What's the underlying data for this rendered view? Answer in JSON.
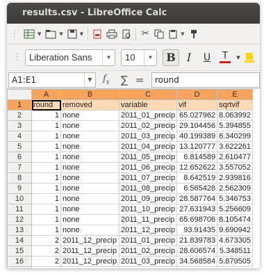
{
  "window": {
    "title": "results.csv - LibreOffice Calc"
  },
  "toolbar": {
    "font_name": "Liberation Sans",
    "font_size": "10",
    "bold_label": "B",
    "italic_label": "I",
    "underline_label": "U"
  },
  "formula_bar": {
    "name_box": "A1:E1",
    "fx_label": "f",
    "fx_sub": "x",
    "sigma_label": "∑",
    "equals_label": "=",
    "content": "round"
  },
  "sheet": {
    "columns": [
      "A",
      "B",
      "C",
      "D",
      "E"
    ],
    "rows": [
      {
        "n": "1",
        "round": "round",
        "removed": "removed",
        "variable": "variable",
        "vif": "vif",
        "sqrtvif": "sqrtvif"
      },
      {
        "n": "2",
        "round": "1",
        "removed": "none",
        "variable": "2011_01_precip",
        "vif": "65.027962",
        "sqrtvif": "8.063992"
      },
      {
        "n": "3",
        "round": "1",
        "removed": "none",
        "variable": "2011_02_precip",
        "vif": "29.104456",
        "sqrtvif": "5.394855"
      },
      {
        "n": "4",
        "round": "1",
        "removed": "none",
        "variable": "2011_03_precip",
        "vif": "40.199389",
        "sqrtvif": "6.340299"
      },
      {
        "n": "5",
        "round": "1",
        "removed": "none",
        "variable": "2011_04_precip",
        "vif": "13.120777",
        "sqrtvif": "3.622261"
      },
      {
        "n": "6",
        "round": "1",
        "removed": "none",
        "variable": "2011_05_precip",
        "vif": "6.814589",
        "sqrtvif": "2.610477"
      },
      {
        "n": "7",
        "round": "1",
        "removed": "none",
        "variable": "2011_06_precip",
        "vif": "12.652622",
        "sqrtvif": "3.557052"
      },
      {
        "n": "8",
        "round": "1",
        "removed": "none",
        "variable": "2011_07_precip",
        "vif": "8.642519",
        "sqrtvif": "2.939816"
      },
      {
        "n": "9",
        "round": "1",
        "removed": "none",
        "variable": "2011_08_precip",
        "vif": "6.565428",
        "sqrtvif": "2.562309"
      },
      {
        "n": "10",
        "round": "1",
        "removed": "none",
        "variable": "2011_09_precip",
        "vif": "28.587764",
        "sqrtvif": "5.346753"
      },
      {
        "n": "11",
        "round": "1",
        "removed": "none",
        "variable": "2011_10_precip",
        "vif": "27.631943",
        "sqrtvif": "5.256609"
      },
      {
        "n": "12",
        "round": "1",
        "removed": "none",
        "variable": "2011_11_precip",
        "vif": "65.698706",
        "sqrtvif": "8.105474"
      },
      {
        "n": "13",
        "round": "1",
        "removed": "none",
        "variable": "2011_12_precip",
        "vif": "93.91435",
        "sqrtvif": "9.690942"
      },
      {
        "n": "14",
        "round": "2",
        "removed": "2011_12_precip",
        "variable": "2011_01_precip",
        "vif": "21.839783",
        "sqrtvif": "4.673305"
      },
      {
        "n": "15",
        "round": "2",
        "removed": "2011_12_precip",
        "variable": "2011_02_precip",
        "vif": "28.606574",
        "sqrtvif": "5.348511"
      },
      {
        "n": "16",
        "round": "2",
        "removed": "2011_12_precip",
        "variable": "2011_03_precip",
        "vif": "34.568584",
        "sqrtvif": "5.879505"
      },
      {
        "n": "17",
        "round": "2",
        "removed": "2011_12_precip",
        "variable": "2011_04_precip",
        "vif": "11.274466",
        "sqrtvif": "3.357747"
      }
    ]
  },
  "colors": {
    "selection_header": "#f7a35c",
    "selection_cell": "#fdd9b5",
    "titlebar": "#3c3b37"
  }
}
